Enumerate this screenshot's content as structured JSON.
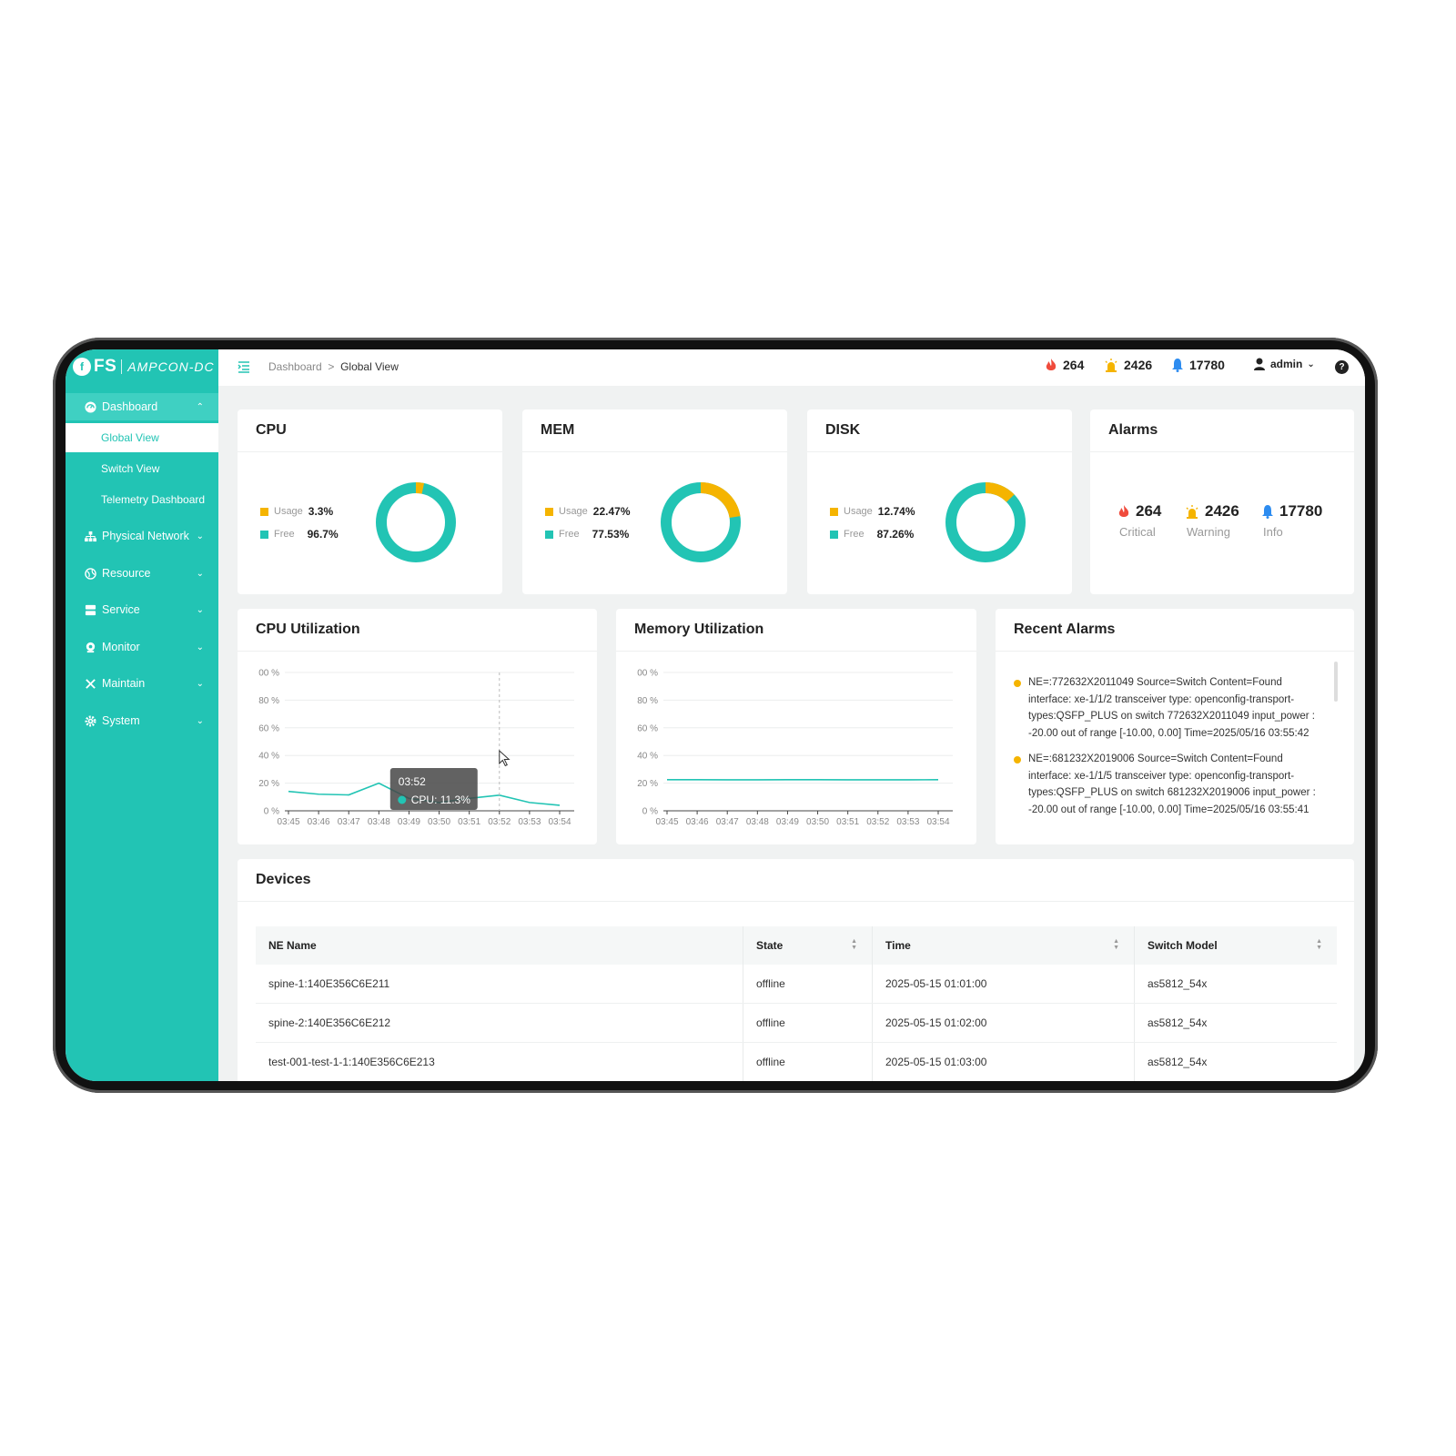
{
  "brand": {
    "logo_text": "FS",
    "product": "AMPCON-DC"
  },
  "sidebar": {
    "dashboard": "Dashboard",
    "sub_items": [
      "Global View",
      "Switch View",
      "Telemetry Dashboard"
    ],
    "items": [
      "Physical Network",
      "Resource",
      "Service",
      "Monitor",
      "Maintain",
      "System"
    ]
  },
  "header": {
    "breadcrumb_root": "Dashboard",
    "breadcrumb_sep": ">",
    "breadcrumb_current": "Global View",
    "critical": "264",
    "warning": "2426",
    "info": "17780",
    "user": "admin",
    "help": "?"
  },
  "cpu": {
    "title": "CPU",
    "usage_label": "Usage",
    "usage": "3.3%",
    "free_label": "Free",
    "free": "96.7%",
    "usage_frac": 0.033
  },
  "mem": {
    "title": "MEM",
    "usage_label": "Usage",
    "usage": "22.47%",
    "free_label": "Free",
    "free": "77.53%",
    "usage_frac": 0.2247
  },
  "disk": {
    "title": "DISK",
    "usage_label": "Usage",
    "usage": "12.74%",
    "free_label": "Free",
    "free": "87.26%",
    "usage_frac": 0.1274
  },
  "alarms": {
    "title": "Alarms",
    "critical": "264",
    "critical_label": "Critical",
    "warning": "2426",
    "warning_label": "Warning",
    "info": "17780",
    "info_label": "Info"
  },
  "colors": {
    "accent": "#22c4b4",
    "usage": "#f5b400",
    "critical": "#f04b3c",
    "info": "#2d8cf0"
  },
  "chart_data": [
    {
      "type": "line",
      "title": "CPU Utilization",
      "x": [
        "03:45",
        "03:46",
        "03:47",
        "03:48",
        "03:49",
        "03:50",
        "03:51",
        "03:52",
        "03:53",
        "03:54"
      ],
      "y_ticks": [
        "00 %",
        "80 %",
        "60 %",
        "40 %",
        "20 %",
        "0 %"
      ],
      "ylim": [
        0,
        100
      ],
      "series": [
        {
          "values": [
            14,
            12,
            11.5,
            20,
            9,
            6,
            9,
            11.3,
            6,
            4
          ]
        }
      ],
      "tooltip": {
        "time": "03:52",
        "label": "CPU: 11.3%"
      }
    },
    {
      "type": "line",
      "title": "Memory Utilization",
      "x": [
        "03:45",
        "03:46",
        "03:47",
        "03:48",
        "03:49",
        "03:50",
        "03:51",
        "03:52",
        "03:53",
        "03:54"
      ],
      "y_ticks": [
        "00 %",
        "80 %",
        "60 %",
        "40 %",
        "20 %",
        "0 %"
      ],
      "ylim": [
        0,
        100
      ],
      "series": [
        {
          "values": [
            22.5,
            22.5,
            22.4,
            22.4,
            22.5,
            22.5,
            22.4,
            22.4,
            22.4,
            22.5
          ]
        }
      ]
    }
  ],
  "recent_alarms": {
    "title": "Recent Alarms",
    "items": [
      "NE=:772632X2011049 Source=Switch Content=Found interface: xe-1/1/2 transceiver type: openconfig-transport-types:QSFP_PLUS on switch 772632X2011049 input_power : -20.00 out of range [-10.00, 0.00] Time=2025/05/16 03:55:42",
      "NE=:681232X2019006 Source=Switch Content=Found interface: xe-1/1/5 transceiver type: openconfig-transport-types:QSFP_PLUS on switch 681232X2019006 input_power : -20.00 out of range [-10.00, 0.00] Time=2025/05/16 03:55:41"
    ]
  },
  "devices": {
    "title": "Devices",
    "columns": [
      "NE Name",
      "State",
      "Time",
      "Switch Model"
    ],
    "rows": [
      [
        "spine-1:140E356C6E211",
        "offline",
        "2025-05-15 01:01:00",
        "as5812_54x"
      ],
      [
        "spine-2:140E356C6E212",
        "offline",
        "2025-05-15 01:02:00",
        "as5812_54x"
      ],
      [
        "test-001-test-1-1:140E356C6E213",
        "offline",
        "2025-05-15 01:03:00",
        "as5812_54x"
      ]
    ]
  }
}
